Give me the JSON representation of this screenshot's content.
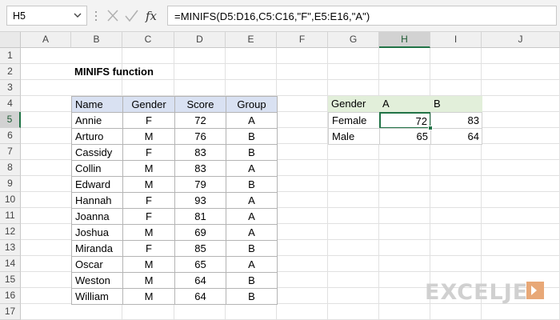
{
  "formula_bar": {
    "name_box": "H5",
    "formula": "=MINIFS(D5:D16,C5:C16,\"F\",E5:E16,\"A\")",
    "fx_label": "fx"
  },
  "grid": {
    "columns": [
      "A",
      "B",
      "C",
      "D",
      "E",
      "F",
      "G",
      "H",
      "I",
      "J"
    ],
    "rows": [
      "1",
      "2",
      "3",
      "4",
      "5",
      "6",
      "7",
      "8",
      "9",
      "10",
      "11",
      "12",
      "13",
      "14",
      "15",
      "16",
      "17"
    ],
    "selected_column": "H",
    "selected_row": "5"
  },
  "sheet": {
    "title": "MINIFS function",
    "main_table": {
      "headers": [
        "Name",
        "Gender",
        "Score",
        "Group"
      ],
      "rows": [
        [
          "Annie",
          "F",
          "72",
          "A"
        ],
        [
          "Arturo",
          "M",
          "76",
          "B"
        ],
        [
          "Cassidy",
          "F",
          "83",
          "B"
        ],
        [
          "Collin",
          "M",
          "83",
          "A"
        ],
        [
          "Edward",
          "M",
          "79",
          "B"
        ],
        [
          "Hannah",
          "F",
          "93",
          "A"
        ],
        [
          "Joanna",
          "F",
          "81",
          "A"
        ],
        [
          "Joshua",
          "M",
          "69",
          "A"
        ],
        [
          "Miranda",
          "F",
          "85",
          "B"
        ],
        [
          "Oscar",
          "M",
          "65",
          "A"
        ],
        [
          "Weston",
          "M",
          "64",
          "B"
        ],
        [
          "William",
          "M",
          "64",
          "B"
        ]
      ]
    },
    "summary_table": {
      "headers": [
        "Gender",
        "A",
        "B"
      ],
      "rows": [
        [
          "Female",
          "72",
          "83"
        ],
        [
          "Male",
          "65",
          "64"
        ]
      ]
    }
  },
  "branding": {
    "logo_text": "EXCELJET",
    "logo_color": "#d0d0d0",
    "accent": "#217346"
  }
}
